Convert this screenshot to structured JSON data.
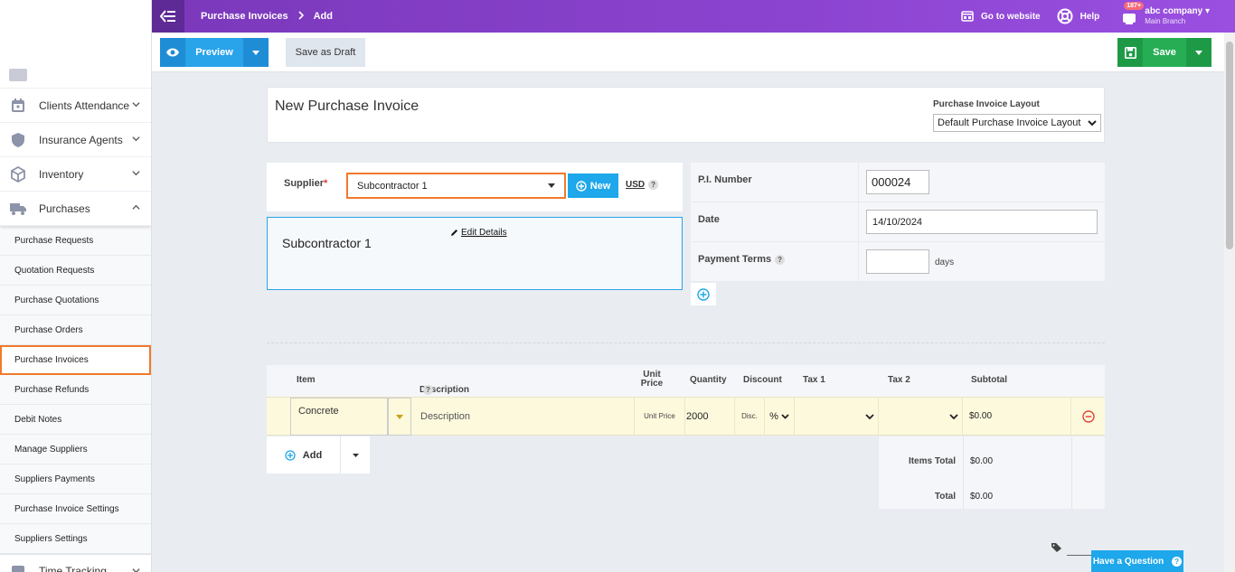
{
  "topbar": {
    "crumb_parent": "Purchase Invoices",
    "crumb_current": "Add",
    "go_to_website": "Go to website",
    "help": "Help",
    "notif_count": "187+",
    "company": "abc company",
    "branch": "Main Branch"
  },
  "sidebar": {
    "items": [
      {
        "label": "Clients Attendance"
      },
      {
        "label": "Insurance Agents"
      },
      {
        "label": "Inventory"
      },
      {
        "label": "Purchases"
      }
    ],
    "subitems": [
      {
        "label": "Purchase Requests"
      },
      {
        "label": "Quotation Requests"
      },
      {
        "label": "Purchase Quotations"
      },
      {
        "label": "Purchase Orders"
      },
      {
        "label": "Purchase Invoices"
      },
      {
        "label": "Purchase Refunds"
      },
      {
        "label": "Debit Notes"
      },
      {
        "label": "Manage Suppliers"
      },
      {
        "label": "Suppliers Payments"
      },
      {
        "label": "Purchase Invoice Settings"
      },
      {
        "label": "Suppliers Settings"
      }
    ],
    "bottom_item": "Time Tracking"
  },
  "actions": {
    "preview": "Preview",
    "save_draft": "Save as Draft",
    "save": "Save"
  },
  "form": {
    "title": "New Purchase Invoice",
    "layout_label": "Purchase Invoice Layout",
    "layout_value": "Default Purchase Invoice Layout",
    "supplier_label": "Supplier",
    "supplier_value": "Subcontractor 1",
    "new_label": "New",
    "currency": "USD",
    "supplier_name": "Subcontractor 1",
    "edit_details": "Edit Details",
    "pi_number_label": "P.I. Number",
    "pi_number": "000024",
    "date_label": "Date",
    "date": "14/10/2024",
    "payment_terms_label": "Payment Terms",
    "days": "days"
  },
  "items": {
    "headers": {
      "item": "Item",
      "description": "Description",
      "unit_price": "Unit Price",
      "quantity": "Quantity",
      "discount": "Discount",
      "tax1": "Tax 1",
      "tax2": "Tax 2",
      "subtotal": "Subtotal"
    },
    "row": {
      "item": "Concrete",
      "description_placeholder": "Description",
      "unit_price_placeholder": "Unit Price",
      "quantity": "2000",
      "discount_placeholder": "Disc.",
      "discount_type": "%",
      "subtotal": "$0.00"
    },
    "add_label": "Add",
    "items_total_label": "Items Total",
    "items_total": "$0.00",
    "total_label": "Total",
    "total": "$0.00"
  },
  "help_button": "Have a Question"
}
